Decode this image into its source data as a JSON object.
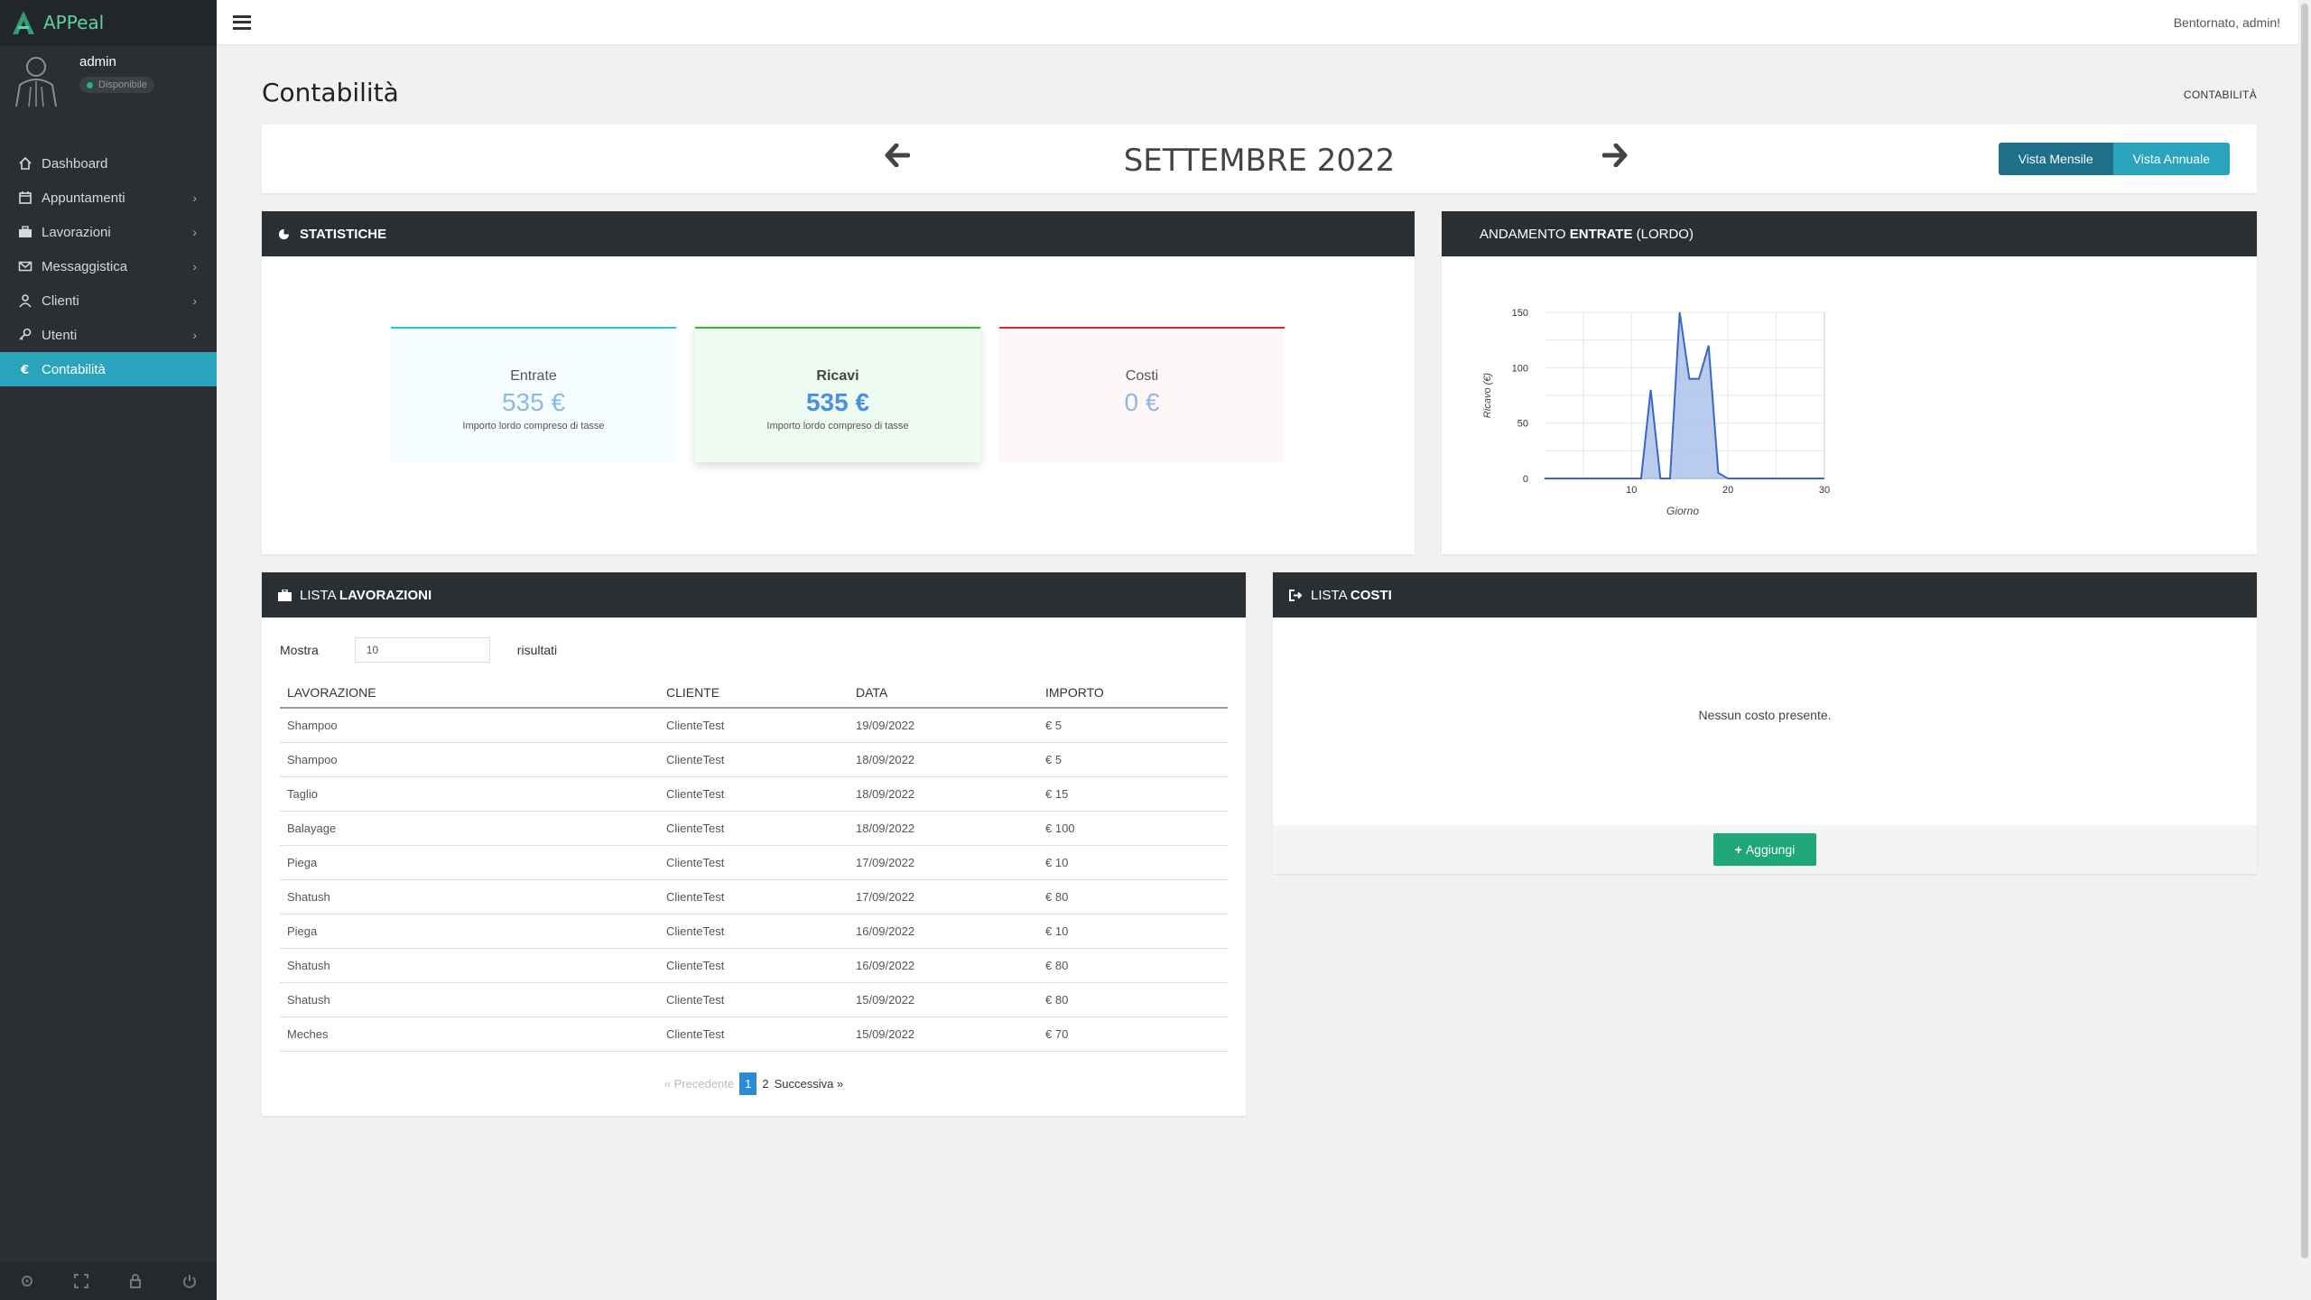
{
  "app": {
    "brand": "APPeal"
  },
  "user": {
    "name": "admin",
    "status": "Disponibile"
  },
  "sidebar": {
    "items": [
      {
        "label": "Dashboard",
        "icon": "home-icon",
        "has_children": false
      },
      {
        "label": "Appuntamenti",
        "icon": "calendar-icon",
        "has_children": true
      },
      {
        "label": "Lavorazioni",
        "icon": "briefcase-icon",
        "has_children": true
      },
      {
        "label": "Messaggistica",
        "icon": "envelope-icon",
        "has_children": true
      },
      {
        "label": "Clienti",
        "icon": "user-icon",
        "has_children": true
      },
      {
        "label": "Utenti",
        "icon": "key-icon",
        "has_children": true
      },
      {
        "label": "Contabilità",
        "icon": "euro-icon",
        "has_children": false,
        "active": true
      }
    ],
    "footer_icons": [
      "settings-icon",
      "fullscreen-icon",
      "lock-icon",
      "power-icon"
    ]
  },
  "topbar": {
    "welcome": "Bentornato, admin!"
  },
  "page": {
    "title": "Contabilità",
    "breadcrumb": "CONTABILITÀ"
  },
  "month_nav": {
    "month": "SETTEMBRE 2022",
    "view_monthly": "Vista Mensile",
    "view_yearly": "Vista Annuale"
  },
  "stats": {
    "title": "STATISTICHE",
    "entrate": {
      "label": "Entrate",
      "value": "535 €",
      "note": "Importo lordo compreso di tasse"
    },
    "ricavi": {
      "label": "Ricavi",
      "value": "535 €",
      "note": "Importo lordo compreso di tasse"
    },
    "costi": {
      "label": "Costi",
      "value": "0 €"
    }
  },
  "trend": {
    "title_prefix": "ANDAMENTO ",
    "title_bold": "ENTRATE",
    "title_suffix": " (LORDO)"
  },
  "chart_data": {
    "type": "area",
    "xlabel": "Giorno",
    "ylabel": "Ricavo (€)",
    "x": [
      1,
      11,
      12,
      13,
      14,
      15,
      16,
      17,
      18,
      19,
      20,
      30
    ],
    "values": [
      0,
      0,
      80,
      0,
      0,
      150,
      90,
      90,
      120,
      5,
      0,
      0
    ],
    "xlim": [
      1,
      30
    ],
    "ylim": [
      0,
      150
    ],
    "xticks": [
      10,
      20,
      30
    ],
    "yticks": [
      0,
      50,
      100,
      150
    ],
    "grid": true,
    "color": "#3a66c8",
    "fill": "#a9bfe8"
  },
  "lavorazioni": {
    "title_prefix": "LISTA ",
    "title_bold": "LAVORAZIONI",
    "show_label": "Mostra",
    "page_size": "10",
    "results_label": "risultati",
    "columns": [
      "LAVORAZIONE",
      "CLIENTE",
      "DATA",
      "IMPORTO"
    ],
    "rows": [
      [
        "Shampoo",
        "ClienteTest",
        "19/09/2022",
        "€ 5"
      ],
      [
        "Shampoo",
        "ClienteTest",
        "18/09/2022",
        "€ 5"
      ],
      [
        "Taglio",
        "ClienteTest",
        "18/09/2022",
        "€ 15"
      ],
      [
        "Balayage",
        "ClienteTest",
        "18/09/2022",
        "€ 100"
      ],
      [
        "Piega",
        "ClienteTest",
        "17/09/2022",
        "€ 10"
      ],
      [
        "Shatush",
        "ClienteTest",
        "17/09/2022",
        "€ 80"
      ],
      [
        "Piega",
        "ClienteTest",
        "16/09/2022",
        "€ 10"
      ],
      [
        "Shatush",
        "ClienteTest",
        "16/09/2022",
        "€ 80"
      ],
      [
        "Shatush",
        "ClienteTest",
        "15/09/2022",
        "€ 80"
      ],
      [
        "Meches",
        "ClienteTest",
        "15/09/2022",
        "€ 70"
      ]
    ],
    "pagination": {
      "prev": "« Precedente",
      "pages": [
        "1",
        "2"
      ],
      "current": "1",
      "next": "Successiva »"
    }
  },
  "costi": {
    "title_prefix": "LISTA ",
    "title_bold": "COSTI",
    "empty": "Nessun costo presente.",
    "add_label": "Aggiungi"
  }
}
